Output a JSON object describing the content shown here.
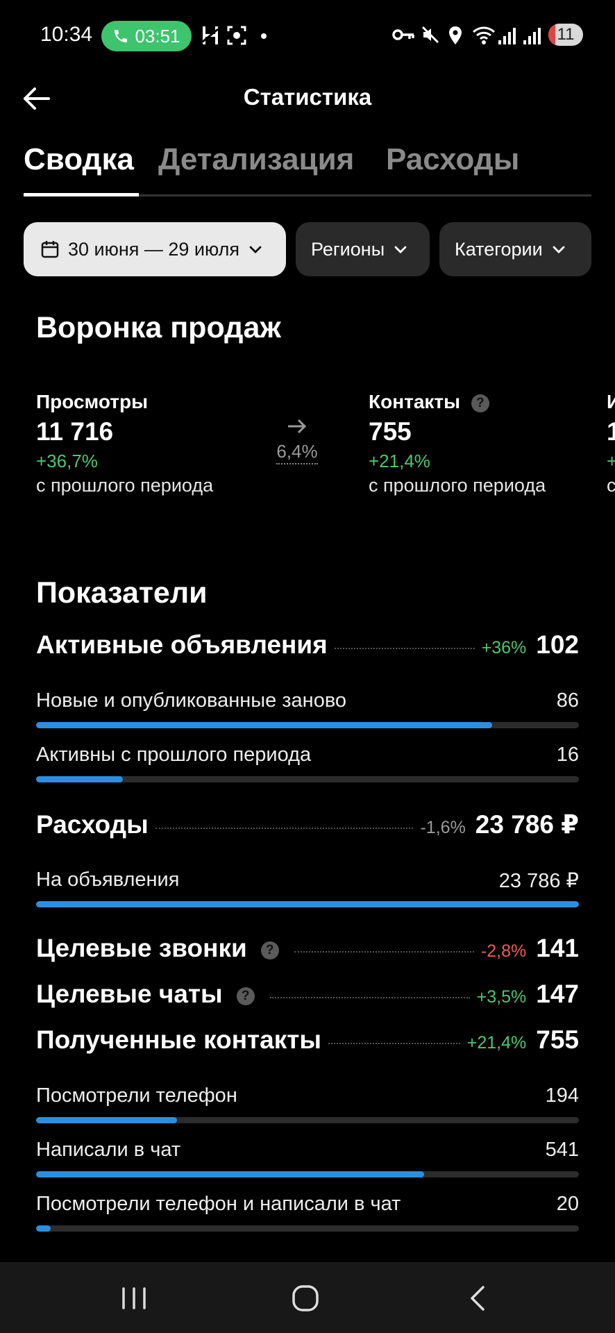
{
  "status_bar": {
    "time": "10:34",
    "call_timer": "03:51",
    "battery": "11"
  },
  "header": {
    "title": "Статистика"
  },
  "tabs": [
    {
      "label": "Сводка",
      "active": true
    },
    {
      "label": "Детализация",
      "active": false
    },
    {
      "label": "Расходы",
      "active": false
    }
  ],
  "filters": {
    "date": "30 июня — 29 июля",
    "regions": "Регионы",
    "categories": "Категории"
  },
  "funnel": {
    "title": "Воронка продаж",
    "items": [
      {
        "label": "Просмотры",
        "value": "11 716",
        "delta": "+36,7%",
        "note": "с прошлого периода"
      },
      {
        "label": "Контакты",
        "value": "755",
        "delta": "+21,4%",
        "note": "с прошлого периода"
      },
      {
        "label": "И",
        "value": "1",
        "delta": "+",
        "note": "с"
      }
    ],
    "conversion": "6,4%"
  },
  "metrics": {
    "title": "Показатели",
    "active_ads": {
      "label": "Активные объявления",
      "delta": "+36%",
      "value": "102"
    },
    "new_ads": {
      "label": "Новые и опубликованные заново",
      "value": "86",
      "fill": 0.84
    },
    "active_prev": {
      "label": "Активны с прошлого периода",
      "value": "16",
      "fill": 0.16
    },
    "expenses": {
      "label": "Расходы",
      "delta": "-1,6%",
      "value": "23 786 ₽"
    },
    "on_ads": {
      "label": "На объявления",
      "value": "23 786 ₽",
      "fill": 1.0
    },
    "target_calls": {
      "label": "Целевые звонки",
      "delta": "-2,8%",
      "value": "141"
    },
    "target_chats": {
      "label": "Целевые чаты",
      "delta": "+3,5%",
      "value": "147"
    },
    "contacts": {
      "label": "Полученные контакты",
      "delta": "+21,4%",
      "value": "755"
    },
    "viewed_phone": {
      "label": "Посмотрели телефон",
      "value": "194",
      "fill": 0.26
    },
    "wrote_chat": {
      "label": "Написали в чат",
      "value": "541",
      "fill": 0.715
    },
    "both": {
      "label": "Посмотрели телефон и написали в чат",
      "value": "20",
      "fill": 0.027
    }
  },
  "colors": {
    "accent_bar": "#2a8fe0",
    "positive": "#4cc76f",
    "negative": "#ef5b5b",
    "call_pill": "#3ec46d"
  }
}
